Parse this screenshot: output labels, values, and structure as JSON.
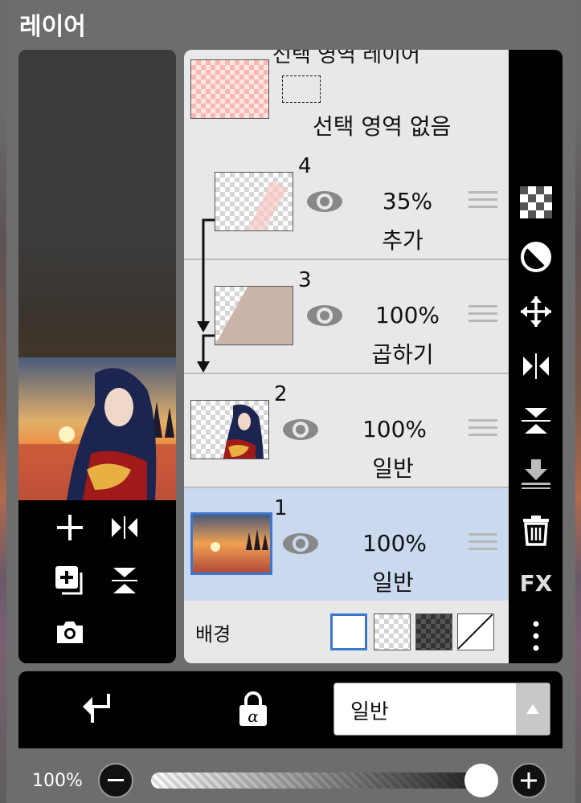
{
  "panel": {
    "title": "레이어"
  },
  "layers": {
    "selection_layer": {
      "title": "선택 영역 레이어",
      "status": "선택 영역 없음"
    },
    "rows": [
      {
        "number": "4",
        "opacity": "35%",
        "blend": "추가",
        "clipped": true,
        "selected": false
      },
      {
        "number": "3",
        "opacity": "100%",
        "blend": "곱하기",
        "clipped": true,
        "selected": false
      },
      {
        "number": "2",
        "opacity": "100%",
        "blend": "일반",
        "clipped": false,
        "selected": false
      },
      {
        "number": "1",
        "opacity": "100%",
        "blend": "일반",
        "clipped": false,
        "selected": true
      }
    ],
    "background": {
      "label": "배경",
      "options": [
        "white",
        "transparent-light",
        "transparent-dark",
        "none"
      ],
      "selected": "white"
    }
  },
  "toolbar": {
    "icons": [
      "checker-icon",
      "contrast-icon",
      "move-icon",
      "flip-horizontal-icon",
      "flip-vertical-icon",
      "merge-down-icon",
      "trash-icon",
      "fx-icon",
      "more-icon"
    ],
    "fx_label": "FX"
  },
  "bottom": {
    "blend_mode": "일반",
    "opacity_label": "100%",
    "opacity_value": 1.0
  },
  "colors": {
    "accent": "#3a78d0",
    "selected_row": "#cad9ee",
    "panel": "#6d6d6d"
  }
}
